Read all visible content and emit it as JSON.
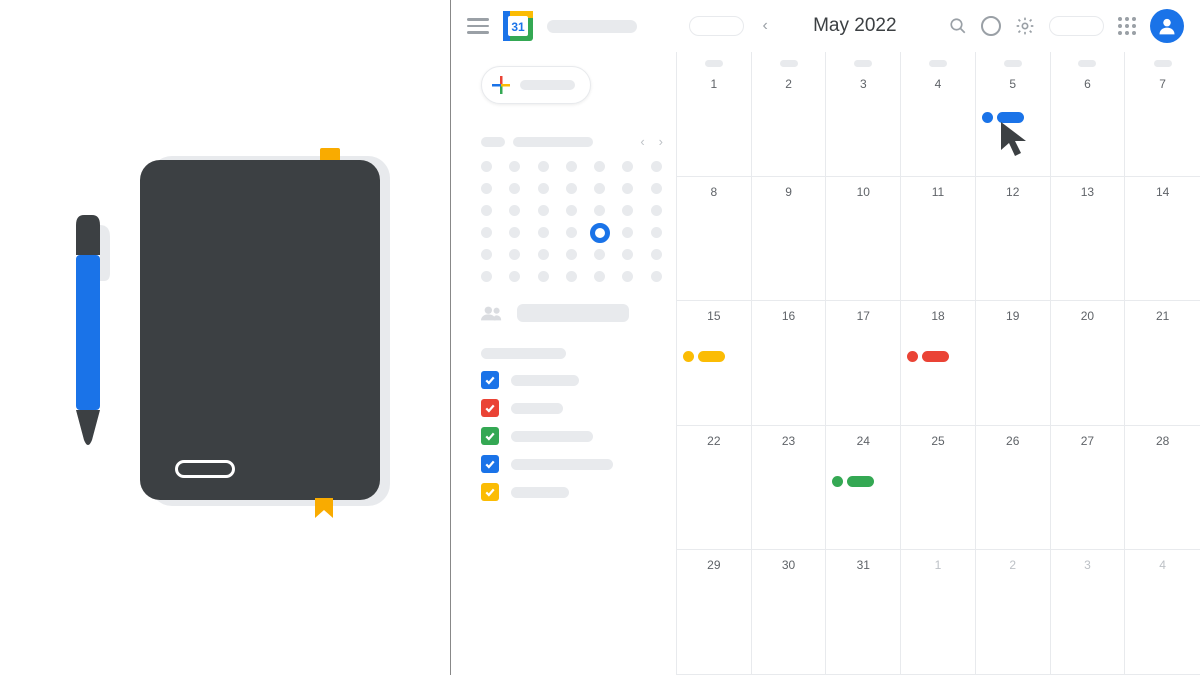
{
  "header": {
    "month_title": "May 2022",
    "logo_day": "31"
  },
  "calendars": [
    {
      "color": "#1a73e8",
      "label_w": 68
    },
    {
      "color": "#ea4335",
      "label_w": 52
    },
    {
      "color": "#34a853",
      "label_w": 82
    },
    {
      "color": "#1a73e8",
      "label_w": 102
    },
    {
      "color": "#fbbc04",
      "label_w": 58
    }
  ],
  "mini_cal": {
    "highlight_index": 25,
    "cells": 42
  },
  "grid": {
    "days": [
      {
        "n": "1"
      },
      {
        "n": "2"
      },
      {
        "n": "3"
      },
      {
        "n": "4"
      },
      {
        "n": "5",
        "event": "#1a73e8",
        "cursor": true
      },
      {
        "n": "6"
      },
      {
        "n": "7"
      },
      {
        "n": "8"
      },
      {
        "n": "9"
      },
      {
        "n": "10"
      },
      {
        "n": "11"
      },
      {
        "n": "12"
      },
      {
        "n": "13"
      },
      {
        "n": "14"
      },
      {
        "n": "15",
        "event": "#fbbc04"
      },
      {
        "n": "16"
      },
      {
        "n": "17"
      },
      {
        "n": "18",
        "event": "#ea4335"
      },
      {
        "n": "19"
      },
      {
        "n": "20"
      },
      {
        "n": "21"
      },
      {
        "n": "22"
      },
      {
        "n": "23"
      },
      {
        "n": "24",
        "event": "#34a853"
      },
      {
        "n": "25"
      },
      {
        "n": "26"
      },
      {
        "n": "27"
      },
      {
        "n": "28"
      },
      {
        "n": "29"
      },
      {
        "n": "30"
      },
      {
        "n": "31"
      },
      {
        "n": "1",
        "muted": true
      },
      {
        "n": "2",
        "muted": true
      },
      {
        "n": "3",
        "muted": true
      },
      {
        "n": "4",
        "muted": true
      }
    ]
  },
  "colors": {
    "blue": "#1a73e8",
    "red": "#ea4335",
    "green": "#34a853",
    "yellow": "#fbbc04",
    "notebook": "#3c4043",
    "grey": "#e8eaed"
  }
}
